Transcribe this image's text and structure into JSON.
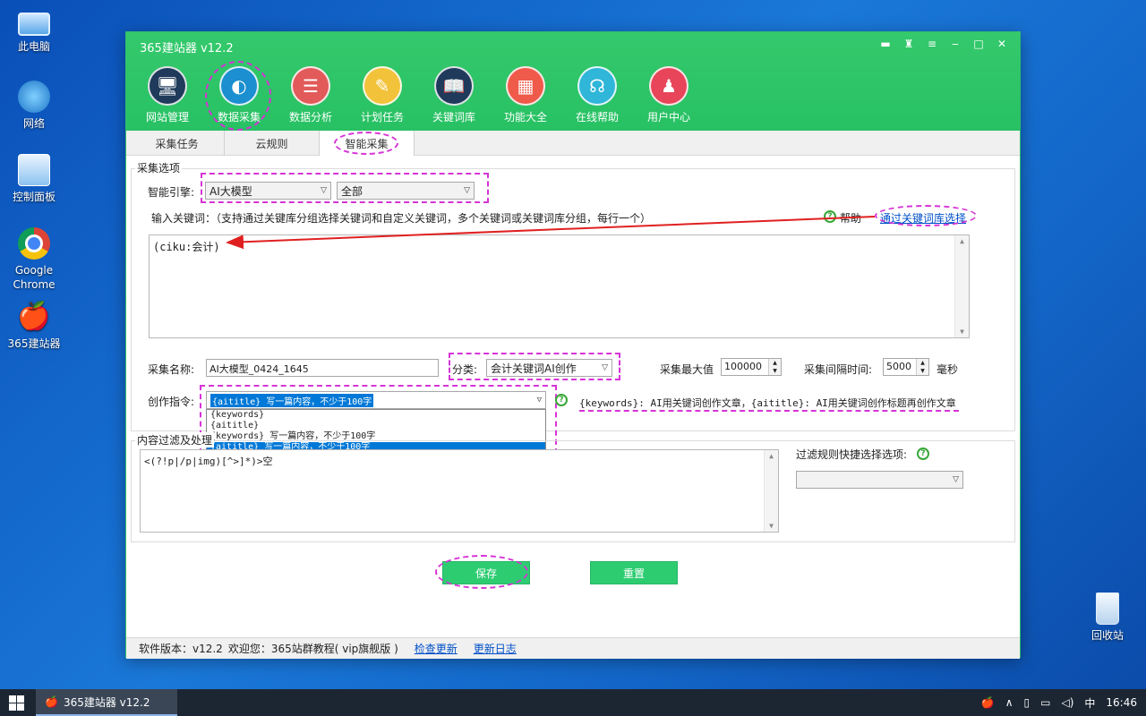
{
  "desktop": {
    "icons": [
      {
        "label": "此电脑",
        "icon": "computer-icon"
      },
      {
        "label": "网络",
        "icon": "network-icon"
      },
      {
        "label": "控制面板",
        "icon": "control-panel-icon"
      },
      {
        "label": "Google Chrome",
        "icon": "chrome-icon"
      },
      {
        "label": "365建站器",
        "icon": "apple-app-icon"
      },
      {
        "label": "回收站",
        "icon": "recycle-bin-icon"
      }
    ]
  },
  "window": {
    "title": "365建站器 v12.2",
    "controls": [
      "chat-icon",
      "shirt-icon",
      "menu-icon",
      "minimize-icon",
      "maximize-icon",
      "close-icon"
    ],
    "nav": [
      {
        "label": "网站管理",
        "icon": "monitor-icon",
        "color": "#1f3a5a"
      },
      {
        "label": "数据采集",
        "icon": "globe-icon",
        "color": "#1b8fd0"
      },
      {
        "label": "数据分析",
        "icon": "database-icon",
        "color": "#e25a5a"
      },
      {
        "label": "计划任务",
        "icon": "clock-icon",
        "color": "#f2c23a"
      },
      {
        "label": "关键词库",
        "icon": "book-icon",
        "color": "#1f3a5a"
      },
      {
        "label": "功能大全",
        "icon": "grid-icon",
        "color": "#ef5a4a"
      },
      {
        "label": "在线帮助",
        "icon": "headset-icon",
        "color": "#2fb6d8"
      },
      {
        "label": "用户中心",
        "icon": "user-icon",
        "color": "#e8455a"
      }
    ],
    "tabs": [
      "采集任务",
      "云规则",
      "智能采集"
    ]
  },
  "form": {
    "group_options": "采集选项",
    "engine_label": "智能引擎:",
    "engine_value": "AI大模型",
    "engine_scope": "全部",
    "keywords_label": "输入关键词：（支持通过关键库分组选择关键词和自定义关键词，多个关键词或关键词库分组，每行一个）",
    "help_label": "帮助",
    "keyword_lib_link": "通过关键词库选择",
    "keywords_value": "(ciku:会计)",
    "name_label": "采集名称:",
    "name_value": "AI大模型_0424_1645",
    "category_label": "分类:",
    "category_value": "会计关键词AI创作",
    "max_label": "采集最大值",
    "max_value": "100000",
    "interval_label": "采集间隔时间:",
    "interval_value": "5000",
    "interval_unit": "毫秒",
    "instruction_label": "创作指令:",
    "instruction_value": "{aititle} 写一篇内容，不少于100字",
    "instruction_options": [
      "{keywords}",
      "{aititle}",
      "{keywords} 写一篇内容，不少于100字",
      "{aititle} 写一篇内容，不少于100字"
    ],
    "instruction_hint": "{keywords}: AI用关键词创作文章，{aititle}: AI用关键词创作标题再创作文章",
    "filter_group": "内容过滤及处理",
    "filter_value": "<(?!p|/p|img)[^>]*)>空",
    "filter_quick_label": "过滤规则快捷选择选项:",
    "save_label": "保存",
    "reset_label": "重置"
  },
  "status": {
    "version": "软件版本：v12.2",
    "welcome": "欢迎您：365站群教程( vip旗舰版 )",
    "check_update": "检查更新",
    "changelog": "更新日志"
  },
  "taskbar": {
    "app_label": "365建站器 v12.2",
    "ime": "中",
    "time": "16:46"
  }
}
